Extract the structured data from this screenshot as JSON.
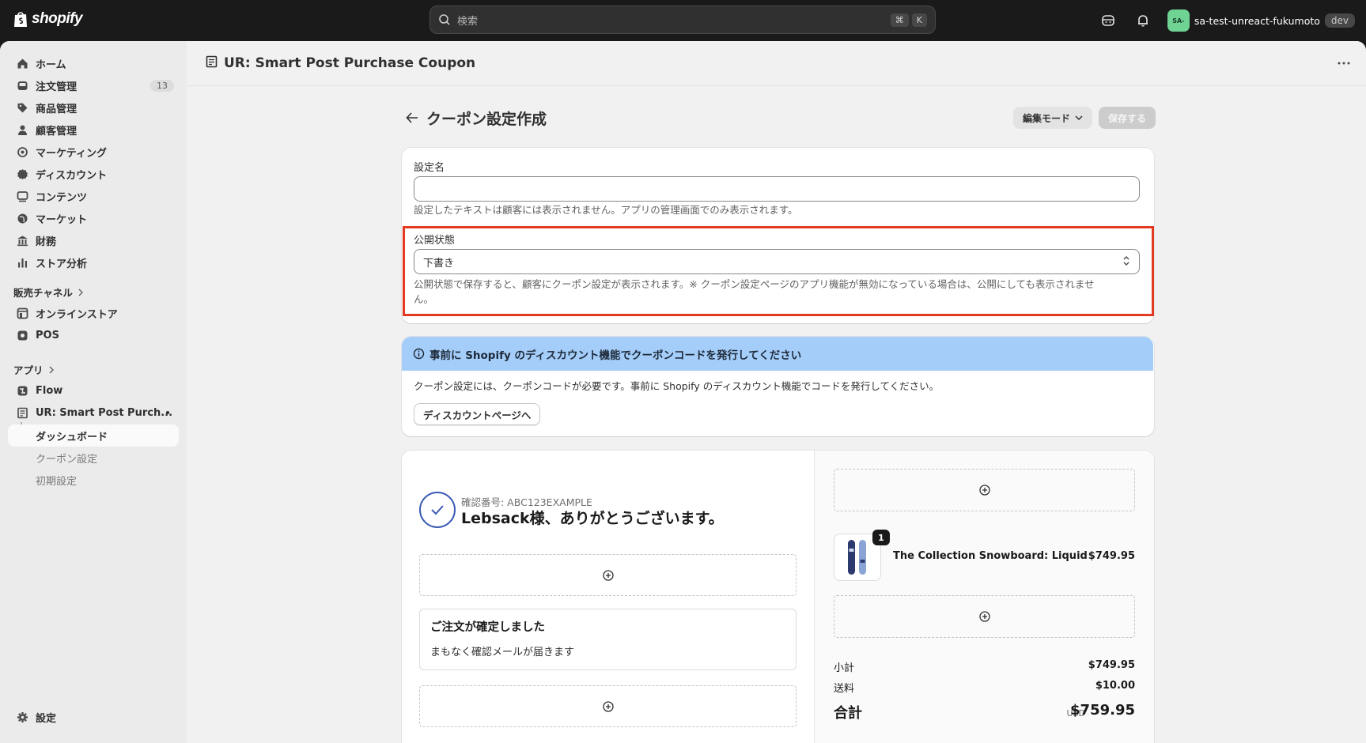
{
  "topbar": {
    "logo_text": "shopify",
    "search_placeholder": "検索",
    "shortcut_keys": [
      "⌘",
      "K"
    ],
    "store_avatar": "SA-",
    "store_name": "sa-test-unreact-fukumoto",
    "badge": "dev"
  },
  "sidebar": {
    "items": [
      {
        "label": "ホーム",
        "icon": "home-icon"
      },
      {
        "label": "注文管理",
        "icon": "inbox-icon",
        "badge": "13"
      },
      {
        "label": "商品管理",
        "icon": "tag-icon"
      },
      {
        "label": "顧客管理",
        "icon": "person-icon"
      },
      {
        "label": "マーケティング",
        "icon": "target-icon"
      },
      {
        "label": "ディスカウント",
        "icon": "discount-icon"
      },
      {
        "label": "コンテンツ",
        "icon": "content-icon"
      },
      {
        "label": "マーケット",
        "icon": "globe-icon"
      },
      {
        "label": "財務",
        "icon": "bank-icon"
      },
      {
        "label": "ストア分析",
        "icon": "chart-icon"
      }
    ],
    "sales_channels_title": "販売チャネル",
    "channels": [
      {
        "label": "オンラインストア",
        "icon": "store-icon"
      },
      {
        "label": "POS",
        "icon": "pos-icon"
      }
    ],
    "apps_title": "アプリ",
    "apps": [
      {
        "label": "Flow",
        "icon": "flow-icon"
      },
      {
        "label": "UR: Smart Post Purch...",
        "icon": "app-icon"
      }
    ],
    "app_subitems": [
      {
        "label": "ダッシュボード"
      },
      {
        "label": "クーポン設定"
      },
      {
        "label": "初期設定"
      }
    ],
    "settings_label": "設定"
  },
  "app_header": {
    "title": "UR: Smart Post Purchase Coupon"
  },
  "page": {
    "title": "クーポン設定作成",
    "mode_button": "編集モード",
    "save_button": "保存する"
  },
  "form": {
    "name_label": "設定名",
    "name_value": "",
    "name_help": "設定したテキストは顧客には表示されません。アプリの管理画面でのみ表示されます。",
    "status_label": "公開状態",
    "status_value": "下書き",
    "status_help": "公開状態で保存すると、顧客にクーポン設定が表示されます。※ クーポン設定ページのアプリ機能が無効になっている場合は、公開にしても表示されませ",
    "status_help_cont": "ん。"
  },
  "banner": {
    "title": "事前に Shopify のディスカウント機能でクーポンコードを発行してください",
    "body": "クーポン設定には、クーポンコードが必要です。事前に Shopify のディスカウント機能でコードを発行してください。",
    "button": "ディスカウントページへ"
  },
  "preview": {
    "confirmation_number": "確認番号: ABC123EXAMPLE",
    "thanks": "Lebsack様、ありがとうございます。",
    "order_title": "ご注文が確定しました",
    "order_sub": "まもなく確認メールが届きます",
    "product": {
      "name": "The Collection Snowboard: Liquid",
      "price": "$749.95",
      "qty": "1"
    },
    "subtotal_label": "小計",
    "subtotal_value": "$749.95",
    "shipping_label": "送料",
    "shipping_value": "$10.00",
    "total_label": "合計",
    "total_currency": "USD",
    "total_value": "$759.95"
  },
  "colors": {
    "highlight": "#e23b22",
    "banner": "#a4cdfa",
    "topbar": "#1a1a1a"
  }
}
